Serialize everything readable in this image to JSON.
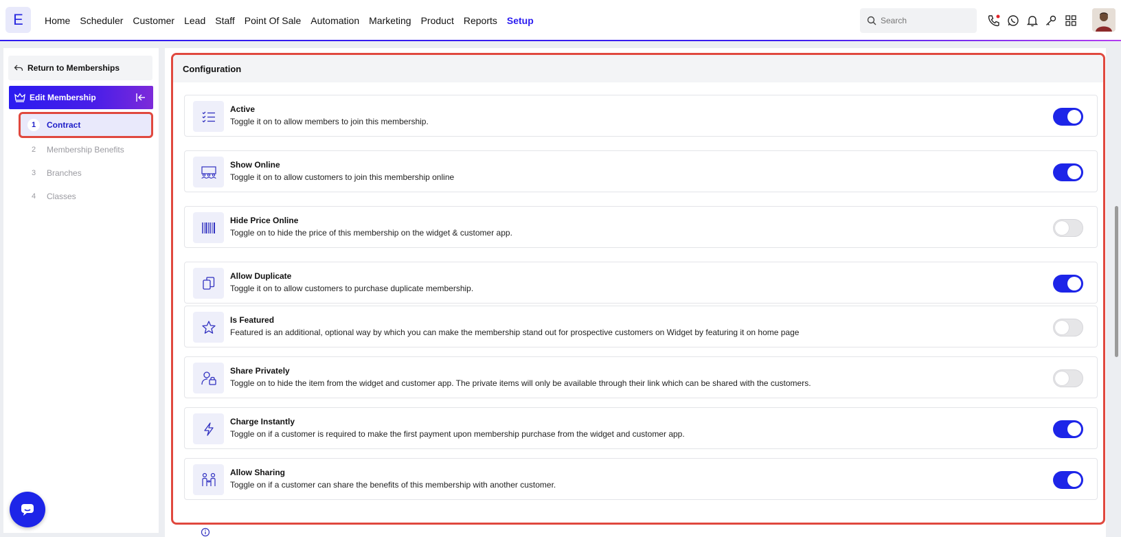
{
  "app": {
    "logo_letter": "E"
  },
  "nav": {
    "items": [
      "Home",
      "Scheduler",
      "Customer",
      "Lead",
      "Staff",
      "Point Of Sale",
      "Automation",
      "Marketing",
      "Product",
      "Reports",
      "Setup"
    ],
    "active": "Setup"
  },
  "search": {
    "placeholder": "Search"
  },
  "toolbar_icons": [
    "phone-icon",
    "whatsapp-icon",
    "bell-icon",
    "key-icon",
    "apps-grid-icon"
  ],
  "sidebar": {
    "return_label": "Return to Memberships",
    "edit_label": "Edit Membership",
    "steps": [
      {
        "num": "1",
        "label": "Contract",
        "active": true
      },
      {
        "num": "2",
        "label": "Membership Benefits",
        "active": false
      },
      {
        "num": "3",
        "label": "Branches",
        "active": false
      },
      {
        "num": "4",
        "label": "Classes",
        "active": false
      }
    ]
  },
  "config": {
    "title": "Configuration",
    "items": [
      {
        "icon": "checklist-icon",
        "title": "Active",
        "desc": "Toggle it on to allow members to join this membership.",
        "on": true
      },
      {
        "icon": "online-group-icon",
        "title": "Show Online",
        "desc": "Toggle it on to allow customers to join this membership online",
        "on": true
      },
      {
        "icon": "barcode-icon",
        "title": "Hide Price Online",
        "desc": "Toggle on to hide the price of this membership on the widget & customer app.",
        "on": false
      },
      {
        "icon": "copy-icon",
        "title": "Allow Duplicate",
        "desc": "Toggle it on to allow customers to purchase duplicate membership.",
        "on": true
      },
      {
        "icon": "star-icon",
        "title": "Is Featured",
        "desc": "Featured is an additional, optional way by which you can make the membership stand out for prospective customers on Widget by featuring it on home page",
        "on": false
      },
      {
        "icon": "user-lock-icon",
        "title": "Share Privately",
        "desc": "Toggle on to hide the item from the widget and customer app. The private items will only be available through their link which can be shared with the customers.",
        "on": false
      },
      {
        "icon": "lightning-icon",
        "title": "Charge Instantly",
        "desc": "Toggle on if a customer is required to make the first payment upon membership purchase from the widget and customer app.",
        "on": true
      },
      {
        "icon": "sharing-people-icon",
        "title": "Allow Sharing",
        "desc": "Toggle on if a customer can share the benefits of this membership with another customer.",
        "on": true
      }
    ]
  },
  "colors": {
    "accent": "#1d25e8",
    "highlight": "#e0483e"
  }
}
